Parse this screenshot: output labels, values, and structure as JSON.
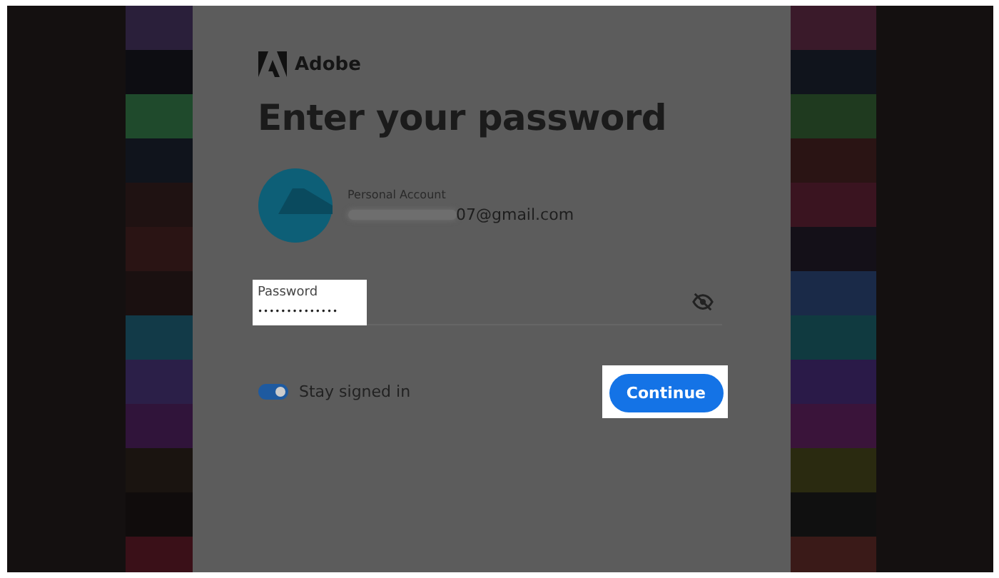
{
  "brand": "Adobe",
  "title": "Enter your password",
  "account": {
    "label": "Personal Account",
    "email": "07@gmail.com",
    "email_redacted": true
  },
  "password": {
    "label": "Password",
    "value": "••••••••••••••",
    "highlighted": true
  },
  "stay_signed_in": {
    "label": "Stay signed in",
    "on": true
  },
  "continue_button": {
    "label": "Continue",
    "highlighted": true
  }
}
